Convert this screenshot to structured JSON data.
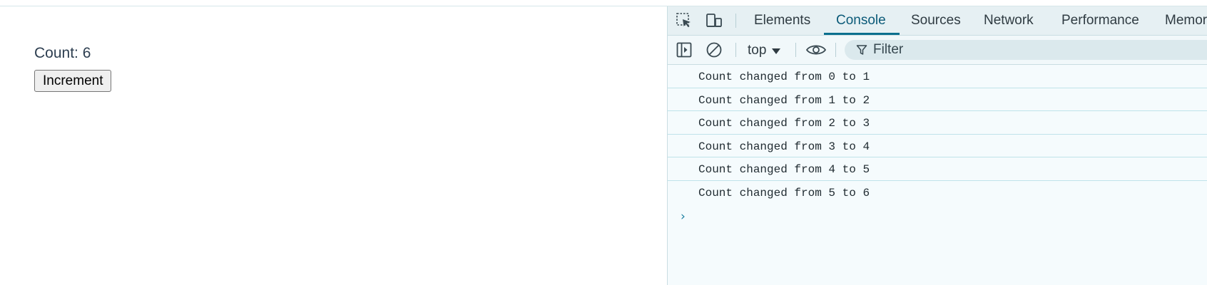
{
  "app": {
    "count_label": "Count: 6",
    "increment_button": "Increment"
  },
  "devtools": {
    "tabs": [
      {
        "label": "Elements"
      },
      {
        "label": "Console"
      },
      {
        "label": "Sources"
      },
      {
        "label": "Network"
      },
      {
        "label": "Performance"
      },
      {
        "label": "Memor"
      }
    ],
    "active_tab": "Console",
    "toolbar": {
      "context": "top",
      "filter_placeholder": "Filter"
    },
    "console_logs": [
      "Count changed from 0 to 1",
      "Count changed from 1 to 2",
      "Count changed from 2 to 3",
      "Count changed from 3 to 4",
      "Count changed from 4 to 5",
      "Count changed from 5 to 6"
    ],
    "prompt_symbol": "›"
  },
  "icons": {
    "inspect": "inspect-element-icon",
    "device": "device-toolbar-icon",
    "sidebar": "sidebar-toggle-icon",
    "clear": "clear-console-icon",
    "eye": "live-expression-eye-icon",
    "filter": "filter-funnel-icon"
  },
  "colors": {
    "accent": "#0b6f8e",
    "devtools_bg": "#f5fbfd",
    "row_divider": "#bfe3ea"
  }
}
